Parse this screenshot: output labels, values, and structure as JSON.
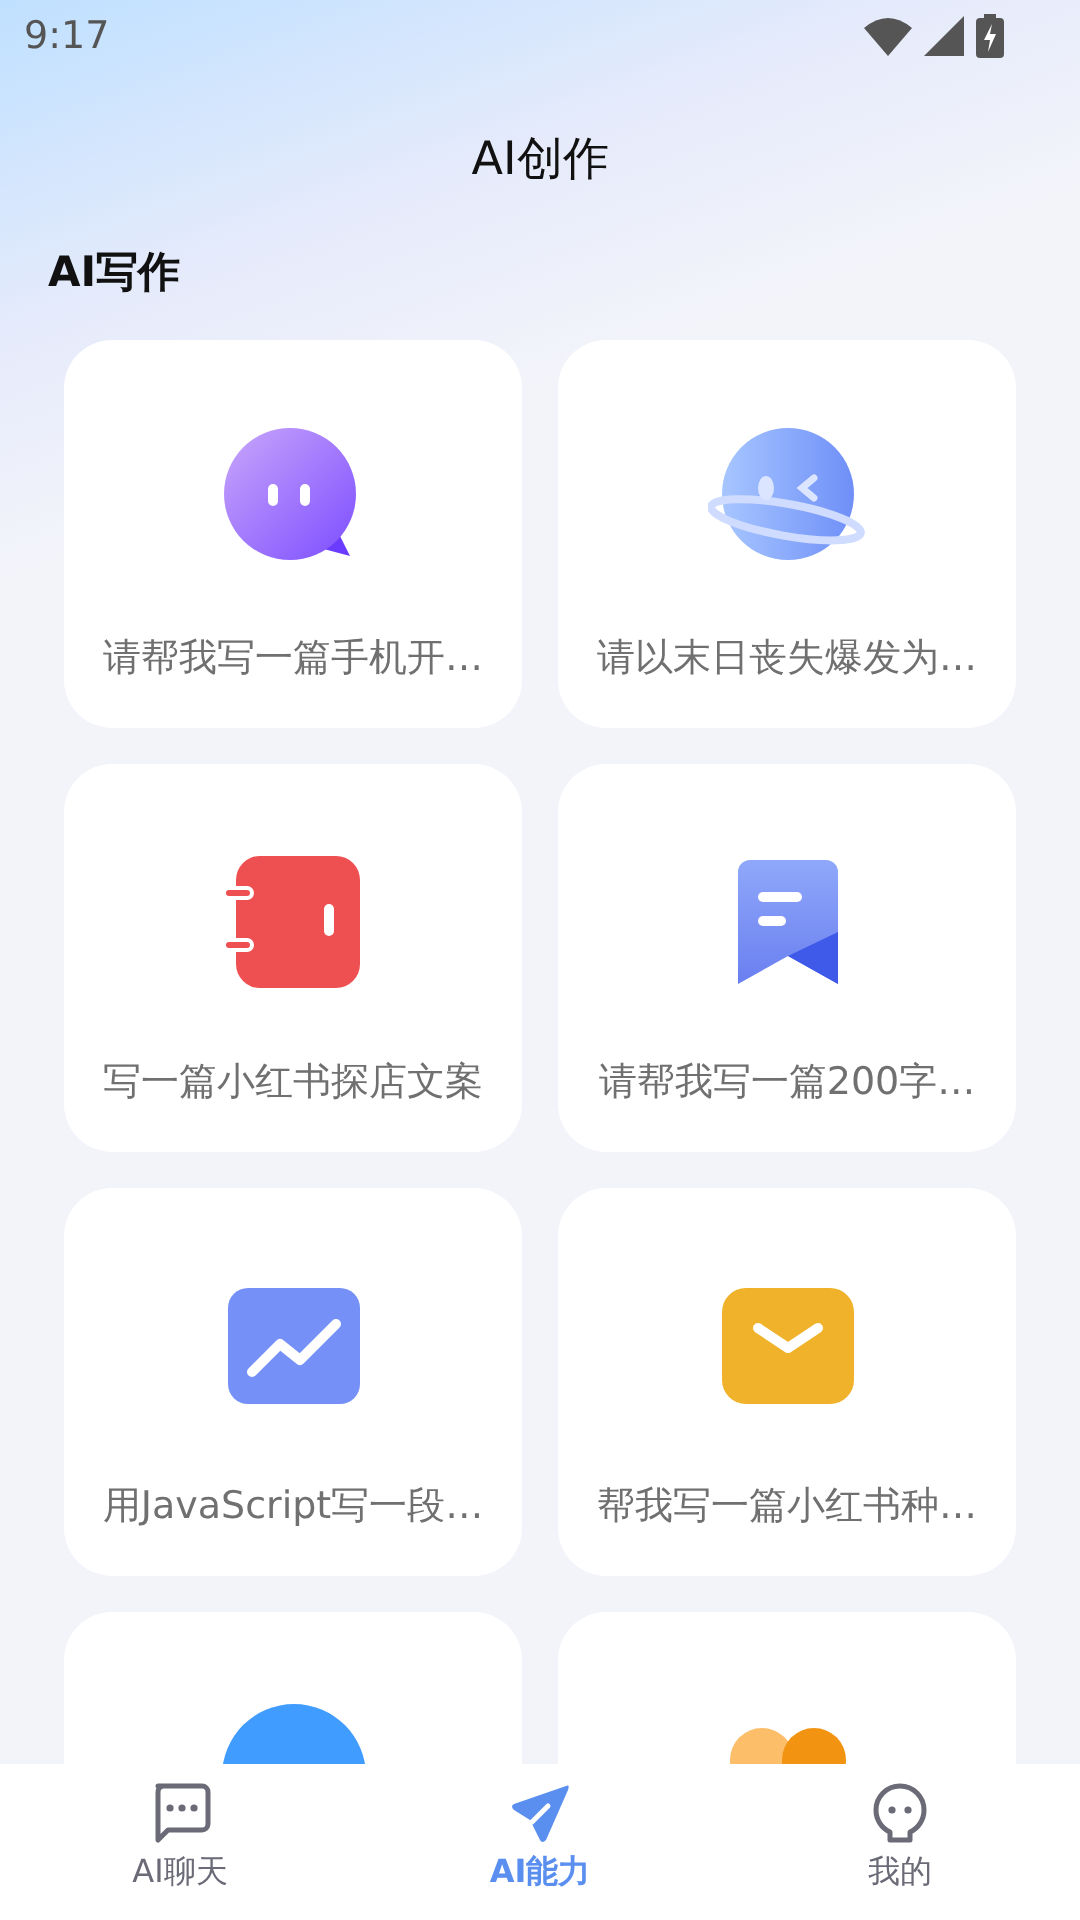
{
  "status_bar": {
    "time": "9:17"
  },
  "header": {
    "title": "AI创作"
  },
  "section": {
    "title": "AI写作",
    "cards": [
      {
        "kind": "chat",
        "text": "请帮我写一篇手机开…"
      },
      {
        "kind": "planet",
        "text": "请以末日丧失爆发为…"
      },
      {
        "kind": "notebook",
        "text": "写一篇小红书探店文案"
      },
      {
        "kind": "bookmark",
        "text": "请帮我写一篇200字…"
      },
      {
        "kind": "chart",
        "text": "用JavaScript写一段…"
      },
      {
        "kind": "mail",
        "text": "帮我写一篇小红书种…"
      },
      {
        "kind": "blue-shape"
      },
      {
        "kind": "people"
      }
    ]
  },
  "tabs": [
    {
      "kind": "chat",
      "label": "AI聊天",
      "selected": false
    },
    {
      "kind": "plane",
      "label": "AI能力",
      "selected": true
    },
    {
      "kind": "ghost",
      "label": "我的",
      "selected": false
    }
  ]
}
